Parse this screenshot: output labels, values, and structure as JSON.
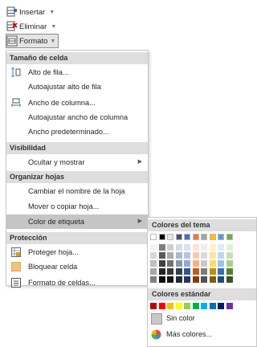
{
  "ribbon": {
    "insert_label": "Insertar",
    "delete_label": "Eliminar",
    "format_label": "Formato"
  },
  "menu": {
    "sections": {
      "cell_size": "Tamaño de celda",
      "visibility": "Visibilidad",
      "organize": "Organizar hojas",
      "protection": "Protección"
    },
    "items": {
      "row_height": "Alto de fila...",
      "autofit_row": "Autoajustar alto de fila",
      "column_width": "Ancho de columna...",
      "autofit_column": "Autoajustar ancho de columna",
      "default_width": "Ancho predeterminado...",
      "hide_show": "Ocultar y mostrar",
      "rename_sheet": "Cambiar el nombre de la hoja",
      "move_copy": "Mover o copiar hoja...",
      "tab_color": "Color de etiqueta",
      "protect_sheet": "Proteger hoja...",
      "lock_cell": "Bloquear celda",
      "format_cells": "Formato de celdas..."
    }
  },
  "submenu": {
    "theme_colors_header": "Colores del tema",
    "standard_colors_header": "Colores estándar",
    "no_color": "Sin color",
    "more_colors": "Más colores...",
    "theme_colors": [
      "#ffffff",
      "#000000",
      "#e7e6e6",
      "#44546a",
      "#4472c4",
      "#ed7d31",
      "#a5a5a5",
      "#ffc000",
      "#5b9bd5",
      "#70ad47"
    ],
    "theme_shades": [
      [
        "#f2f2f2",
        "#d9d9d9",
        "#bfbfbf",
        "#a6a6a6",
        "#808080"
      ],
      [
        "#7f7f7f",
        "#595959",
        "#404040",
        "#262626",
        "#0d0d0d"
      ],
      [
        "#d0cece",
        "#aeaaaa",
        "#757171",
        "#3a3838",
        "#171616"
      ],
      [
        "#d6dce4",
        "#adb9ca",
        "#8497b0",
        "#333f4f",
        "#222a35"
      ],
      [
        "#d9e2f3",
        "#b4c6e7",
        "#8eaadb",
        "#2f5496",
        "#1f3864"
      ],
      [
        "#fbe4d5",
        "#f7caac",
        "#f4b083",
        "#c55a11",
        "#833c0b"
      ],
      [
        "#ededed",
        "#dbdbdb",
        "#c9c9c9",
        "#7b7b7b",
        "#525252"
      ],
      [
        "#fff2cc",
        "#ffe599",
        "#ffd966",
        "#bf8f00",
        "#7f6000"
      ],
      [
        "#deebf6",
        "#bdd7ee",
        "#9cc3e5",
        "#2e74b5",
        "#1f4e79"
      ],
      [
        "#e2efd9",
        "#c5e0b3",
        "#a8d08d",
        "#538135",
        "#375623"
      ]
    ],
    "standard_colors": [
      "#c00000",
      "#ff0000",
      "#ffc000",
      "#ffff00",
      "#92d050",
      "#00b050",
      "#00b0f0",
      "#0070c0",
      "#002060",
      "#7030a0"
    ]
  }
}
